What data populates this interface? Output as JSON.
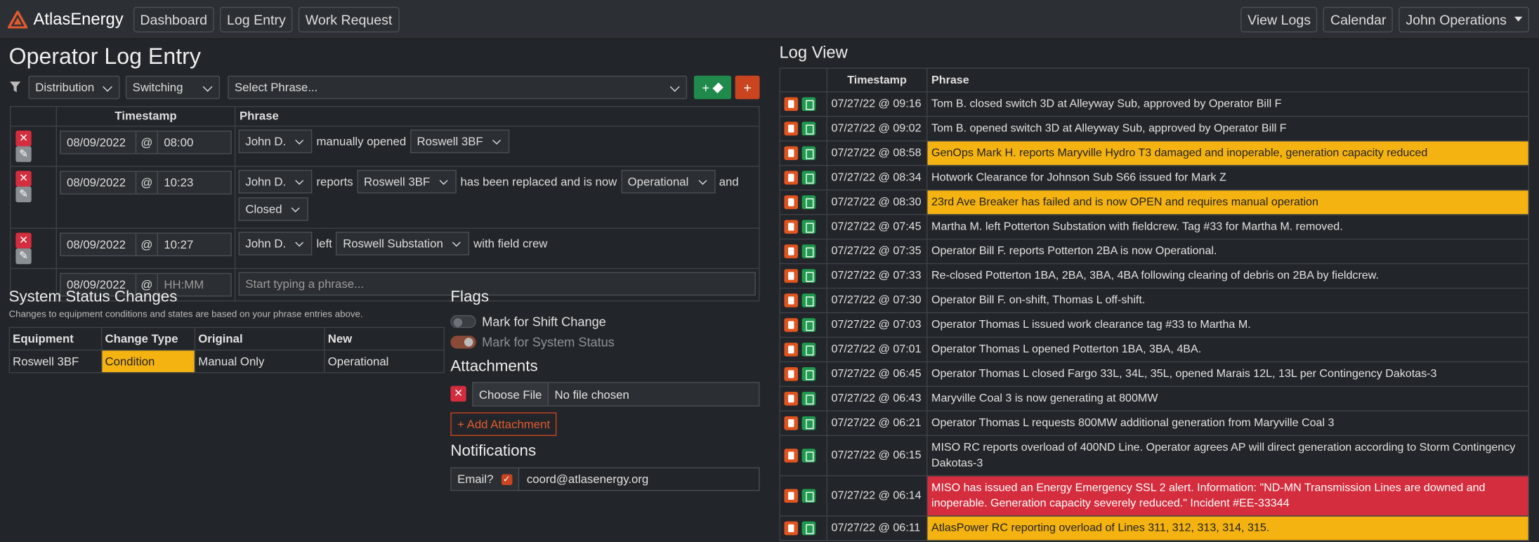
{
  "nav": {
    "brand": "AtlasEnergy",
    "links": [
      "Dashboard",
      "Log Entry",
      "Work Request"
    ],
    "right": {
      "view_logs": "View Logs",
      "calendar": "Calendar",
      "user": "John Operations"
    }
  },
  "entry": {
    "title": "Operator Log Entry",
    "filter_icon": "filter-icon",
    "filters": {
      "category": "Distribution",
      "subcategory": "Switching",
      "phrase_placeholder": "Select Phrase..."
    },
    "headers": {
      "timestamp": "Timestamp",
      "phrase": "Phrase"
    },
    "at": "@",
    "rows": [
      {
        "date": "08/09/2022",
        "time": "08:00",
        "who": "John D.",
        "t1": "manually opened",
        "s1": "Roswell 3BF"
      },
      {
        "date": "08/09/2022",
        "time": "10:23",
        "who": "John D.",
        "t1": "reports",
        "s1": "Roswell 3BF",
        "t2": "has been replaced and is now",
        "s2": "Operational",
        "t3": "and",
        "s3": "Closed"
      },
      {
        "date": "08/09/2022",
        "time": "10:27",
        "who": "John D.",
        "t1": "left",
        "s1": "Roswell Substation",
        "t2": "with field crew"
      }
    ],
    "new_row": {
      "date": "08/09/2022",
      "time_placeholder": "HH:MM",
      "phrase_placeholder": "Start typing a phrase..."
    }
  },
  "system": {
    "title": "System Status Changes",
    "subtitle": "Changes to equipment conditions and states are based on your phrase entries above.",
    "headers": [
      "Equipment",
      "Change Type",
      "Original",
      "New"
    ],
    "rows": [
      {
        "equipment": "Roswell 3BF",
        "change_type": "Condition",
        "original": "Manual Only",
        "new": "Operational"
      }
    ]
  },
  "flags": {
    "title": "Flags",
    "shift_change": "Mark for Shift Change",
    "system_status": "Mark for System Status",
    "shift_change_on": false,
    "system_status_on": true
  },
  "attachments": {
    "title": "Attachments",
    "choose_file": "Choose File",
    "file_name": "No file chosen",
    "add": "+ Add Attachment"
  },
  "notifications": {
    "title": "Notifications",
    "email_label": "Email?",
    "email_checked": true,
    "email": "coord@atlasenergy.org"
  },
  "log": {
    "title": "Log View",
    "headers": {
      "timestamp": "Timestamp",
      "phrase": "Phrase"
    },
    "rows": [
      {
        "ts": "07/27/22 @ 09:16",
        "phrase": "Tom B. closed switch 3D at Alleyway Sub, approved by Operator Bill F",
        "hl": ""
      },
      {
        "ts": "07/27/22 @ 09:02",
        "phrase": "Tom B. opened switch 3D at Alleyway Sub, approved by Operator Bill F",
        "hl": ""
      },
      {
        "ts": "07/27/22 @ 08:58",
        "phrase": "GenOps Mark H. reports Maryville Hydro T3 damaged and inoperable, generation capacity reduced",
        "hl": "yellow"
      },
      {
        "ts": "07/27/22 @ 08:34",
        "phrase": "Hotwork Clearance for Johnson Sub S66 issued for Mark Z",
        "hl": ""
      },
      {
        "ts": "07/27/22 @ 08:30",
        "phrase": "23rd Ave Breaker has failed and is now OPEN and requires manual operation",
        "hl": "yellow"
      },
      {
        "ts": "07/27/22 @ 07:45",
        "phrase": "Martha M. left Potterton Substation with fieldcrew. Tag #33 for Martha M. removed.",
        "hl": ""
      },
      {
        "ts": "07/27/22 @ 07:35",
        "phrase": "Operator Bill F. reports Potterton 2BA is now Operational.",
        "hl": ""
      },
      {
        "ts": "07/27/22 @ 07:33",
        "phrase": "Re-closed Potterton 1BA, 2BA, 3BA, 4BA following clearing of debris on 2BA by fieldcrew.",
        "hl": ""
      },
      {
        "ts": "07/27/22 @ 07:30",
        "phrase": "Operator Bill F. on-shift, Thomas L off-shift.",
        "hl": ""
      },
      {
        "ts": "07/27/22 @ 07:03",
        "phrase": "Operator Thomas L issued work clearance tag #33 to Martha M.",
        "hl": ""
      },
      {
        "ts": "07/27/22 @ 07:01",
        "phrase": "Operator Thomas L opened Potterton 1BA, 3BA, 4BA.",
        "hl": ""
      },
      {
        "ts": "07/27/22 @ 06:45",
        "phrase": "Operator Thomas L closed Fargo 33L, 34L, 35L, opened Marais 12L, 13L per Contingency Dakotas-3",
        "hl": ""
      },
      {
        "ts": "07/27/22 @ 06:43",
        "phrase": "Maryville Coal 3 is now generating at 800MW",
        "hl": ""
      },
      {
        "ts": "07/27/22 @ 06:21",
        "phrase": "Operator Thomas L requests 800MW additional generation from Maryville Coal 3",
        "hl": ""
      },
      {
        "ts": "07/27/22 @ 06:15",
        "phrase": "MISO RC reports overload of 400ND Line. Operator agrees AP will direct generation according to Storm Contingency Dakotas-3",
        "hl": ""
      },
      {
        "ts": "07/27/22 @ 06:14",
        "phrase": "MISO has issued an Energy Emergency SSL 2 alert. Information: \"ND-MN Transmission Lines are downed and inoperable. Generation capacity severely reduced.\" Incident #EE-33344",
        "hl": "red"
      },
      {
        "ts": "07/27/22 @ 06:11",
        "phrase": "AtlasPower RC reporting overload of Lines 311, 312, 313, 314, 315.",
        "hl": "yellow"
      }
    ]
  },
  "colors": {
    "accent": "#c9441f",
    "green": "#1f8a4c",
    "highlight_yellow": "#f5b311",
    "highlight_red": "#d42d3e",
    "background": "#222529"
  }
}
